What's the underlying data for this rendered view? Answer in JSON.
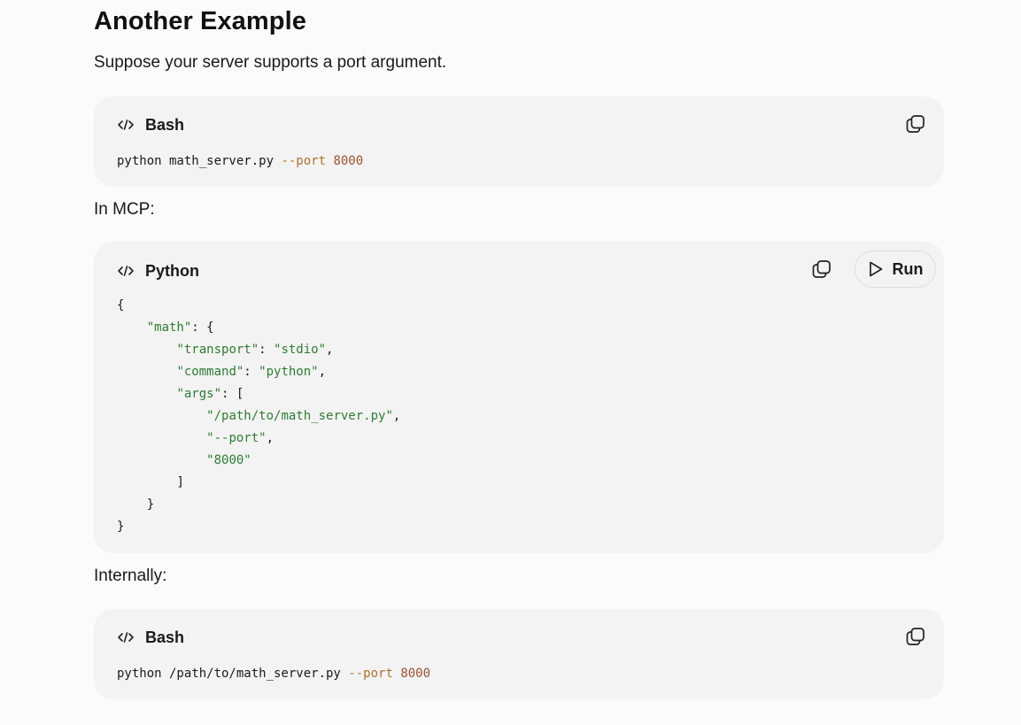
{
  "heading": "Another Example",
  "intro": "Suppose your server supports a port argument.",
  "block1": {
    "lang": "Bash",
    "cmd": "python math_server.py ",
    "flag": "--port",
    "value": "8000"
  },
  "label_mcp": "In MCP:",
  "block2": {
    "lang": "Python",
    "run_label": "Run",
    "lines": {
      "open": "{",
      "math_key": "\"math\"",
      "transport_key": "\"transport\"",
      "transport_val": "\"stdio\"",
      "command_key": "\"command\"",
      "command_val": "\"python\"",
      "args_key": "\"args\"",
      "arg1": "\"/path/to/math_server.py\"",
      "arg2": "\"--port\"",
      "arg3": "\"8000\"",
      "close_bracket": "]",
      "close_inner": "}",
      "close": "}"
    }
  },
  "label_internal": "Internally:",
  "block3": {
    "lang": "Bash",
    "cmd": "python /path/to/math_server.py ",
    "flag": "--port",
    "value": "8000"
  },
  "icons": {
    "code": "code-icon",
    "copy": "copy-icon",
    "play": "play-icon"
  }
}
